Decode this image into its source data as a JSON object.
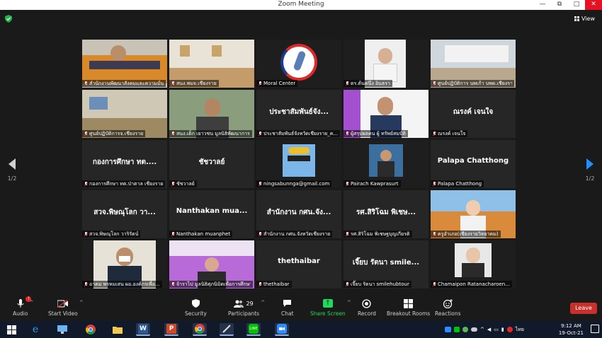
{
  "window": {
    "title": "Zoom Meeting",
    "controls": [
      "—",
      "⧉",
      "□",
      "✕"
    ]
  },
  "view_button": "View",
  "pagination": {
    "left": "1/2",
    "right": "1/2"
  },
  "participants": [
    {
      "label": "สำนักงานพัฒนาสังคมและความมั่นคงฯ เชียงราย",
      "big": "",
      "video": "meeting_room_monks",
      "active": true
    },
    {
      "label": "สนง.พมจ.เชียงราย",
      "big": "",
      "video": "office_room",
      "active": false
    },
    {
      "label": "Moral Center",
      "big": "",
      "video": "moral_center_logo",
      "active": false
    },
    {
      "label": "ดร.ต้นคนึง อินธรา",
      "big": "",
      "video": "woman_video",
      "active": false
    },
    {
      "label": "ศูนย์ปฏิบัติการ นพเก้า บพด.เชียงราย",
      "big": "",
      "video": "building_sign",
      "active": false
    },
    {
      "label": "ศูนย์ปฏิบัติการจ.เชียงราย",
      "big": "",
      "video": "office_room_2",
      "active": false
    },
    {
      "label": "สนง.เด็ก เยาวชน มูลนิธิพัฒนาการ",
      "big": "",
      "video": "man_office",
      "active": false
    },
    {
      "label": "ประชาสัมพันธ์จังหวัดเชียงราย_ค...",
      "big": "ประชาสัมพันธ์จัง...",
      "video": "",
      "active": false
    },
    {
      "label": "ผู้สรุปผลคน ผู้ ทรัพย์สมบัติ",
      "big": "",
      "video": "man_slide",
      "active": false
    },
    {
      "label": "ณรงค์ เจนใจ",
      "big": "ณรงค์ เจนใจ",
      "video": "",
      "active": false
    },
    {
      "label": "กองการศึกษา ทต.ป่าตาล เชียงราย",
      "big": "กองการศึกษา ทต....",
      "video": "",
      "active": false
    },
    {
      "label": "ชัชวาลย์",
      "big": "ชัชวาลย์",
      "video": "",
      "active": false
    },
    {
      "label": "ningsabunnga@gmail.com",
      "big": "",
      "video": "cyclist_photo",
      "active": false
    },
    {
      "label": "Pairach Kawprasurt",
      "big": "",
      "video": "man_standing",
      "active": false
    },
    {
      "label": "Palapa Chatthong",
      "big": "Palapa Chatthong",
      "video": "",
      "active": false
    },
    {
      "label": "สวจ.พิษณุโลก วาริรัตน์",
      "big": "สวจ.พิษณุโลก วา...",
      "video": "",
      "active": false
    },
    {
      "label": "Nanthakan muanphet",
      "big": "Nanthakan mua...",
      "video": "",
      "active": false
    },
    {
      "label": "สำนักงาน กศน.จังหวัดเชียงราย",
      "big": "สำนักงาน กศน.จัง...",
      "video": "",
      "active": false
    },
    {
      "label": "รศ.สิริโฉม พิเชษฐบุญเกียรติ",
      "big": "รศ.สิริโฉม พิเชษ...",
      "video": "",
      "active": false
    },
    {
      "label": "ครูอำเภอ(เชียงรายวิทยาคม)",
      "big": "",
      "video": "woman_building",
      "active": false
    },
    {
      "label": "อาคม พรหมเสน ผอ.องค์กรเพื่อ...",
      "big": "",
      "video": "man_mask",
      "active": false
    },
    {
      "label": "จ้าราไป มูลนิธิศุภนิมิตเพื่อการศึกษา",
      "big": "",
      "video": "woman_banner",
      "active": false
    },
    {
      "label": "thethaibar",
      "big": "thethaibar",
      "video": "",
      "active": false
    },
    {
      "label": "เจี๊ยบ รัตนา smilehubtour",
      "big": "เจี๊ยบ รัตนา smile...",
      "video": "",
      "active": false
    },
    {
      "label": "Chamaipon Ratanacharoen...",
      "big": "",
      "video": "woman_portrait",
      "active": false
    }
  ],
  "toolbar": {
    "audio": "Audio",
    "start_video": "Start Video",
    "security": "Security",
    "participants": "Participants",
    "participants_count": "29",
    "chat": "Chat",
    "share_screen": "Share Screen",
    "record": "Record",
    "breakout_rooms": "Breakout Rooms",
    "reactions": "Reactions",
    "leave": "Leave"
  },
  "taskbar": {
    "apps": [
      "windows-icon",
      "internet-explorer-icon",
      "monitor-icon",
      "chrome-icon",
      "file-explorer-icon",
      "word-icon",
      "powerpoint-icon",
      "chrome-icon",
      "pen-tool-icon",
      "line-icon",
      "zoom-icon"
    ],
    "clock_time": "9:12 AM",
    "clock_date": "19-Oct-21",
    "lang": "ไทย"
  },
  "colors": {
    "active_border": "#c6e24a",
    "leave": "#c8302b",
    "share": "#23d95c",
    "arrow_right": "#1e90ff"
  }
}
